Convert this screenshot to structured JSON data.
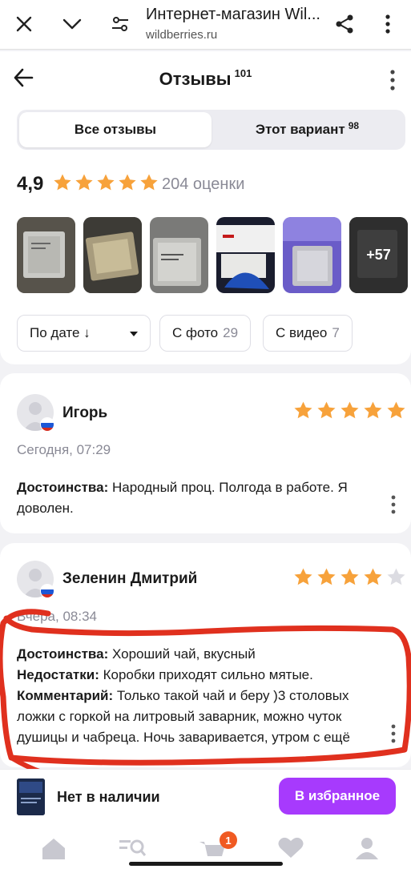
{
  "browser": {
    "title": "Интернет-магазин Wil...",
    "url": "wildberries.ru"
  },
  "header": {
    "title": "Отзывы",
    "count": "101"
  },
  "tabs": [
    {
      "label": "Все отзывы",
      "count": ""
    },
    {
      "label": "Этот вариант",
      "count": "98"
    }
  ],
  "summary": {
    "rating": "4,9",
    "stars": 5,
    "ratings_count": "204 оценки"
  },
  "photos": {
    "more_label": "+57"
  },
  "filters": {
    "sort_label": "По дате ↓",
    "photo_label": "С фото",
    "photo_count": "29",
    "video_label": "С видео",
    "video_count": "7"
  },
  "reviews": [
    {
      "author": "Игорь",
      "stars": 5,
      "date": "Сегодня, 07:29",
      "pros_label": "Достоинства:",
      "pros_text": "Народный проц. Полгода в работе. Я доволен."
    },
    {
      "author": "Зеленин Дмитрий",
      "stars": 4,
      "date": "Вчера, 08:34",
      "pros_label": "Достоинства:",
      "pros_text": "Хороший чай, вкусный",
      "cons_label": "Недостатки:",
      "cons_text": "Коробки приходят сильно мятые.",
      "comment_label": "Комментарий:",
      "comment_text": "Только такой чай и беру )3 столовых ложки с горкой на литровый заварник, можно чуток душицы и чабреца. Ночь заваривается, утром с ещё"
    }
  ],
  "product_bar": {
    "stock_text": "Нет в наличии",
    "fav_button": "В избранное"
  },
  "nav": {
    "cart_badge": "1"
  },
  "colors": {
    "accent": "#a73afd",
    "star": "#f7a23b",
    "badge": "#f05a22",
    "annotation": "#e0301e"
  }
}
